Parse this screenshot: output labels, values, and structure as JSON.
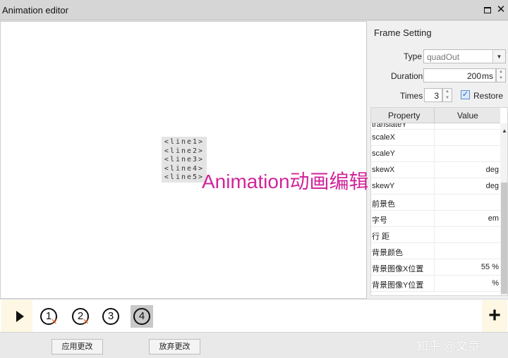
{
  "window": {
    "title": "Animation editor"
  },
  "canvas": {
    "lines": [
      "<line1>",
      "<line2>",
      "<line3>",
      "<line4>",
      "<line5>"
    ],
    "overlay_caption": "Animation动画编辑"
  },
  "frame_setting": {
    "title": "Frame Setting",
    "type_label": "Type",
    "type_value": "quadOut",
    "duration_label": "Duration",
    "duration_value": "200",
    "duration_unit": "ms",
    "times_label": "Times",
    "times_value": "3",
    "restore_label": "Restore",
    "restore_checked": true
  },
  "property_table": {
    "headers": [
      "Property",
      "Value"
    ],
    "partial_row": "translateY",
    "rows": [
      {
        "name": "scaleX",
        "value": ""
      },
      {
        "name": "scaleY",
        "value": ""
      },
      {
        "name": "skewX",
        "value": "deg"
      },
      {
        "name": "skewY",
        "value": "deg"
      },
      {
        "name": "前景色",
        "value": ""
      },
      {
        "name": "字号",
        "value": "em"
      },
      {
        "name": "行 距",
        "value": ""
      },
      {
        "name": "背景颜色",
        "value": ""
      },
      {
        "name": "背景图像X位置",
        "value": "55 %"
      },
      {
        "name": "背景图像Y位置",
        "value": "%"
      }
    ]
  },
  "timeline": {
    "frames": [
      {
        "label": "1",
        "has_x": true
      },
      {
        "label": "2",
        "has_x": true
      },
      {
        "label": "3",
        "has_x": false
      },
      {
        "label": "4",
        "has_x": false,
        "selected": true
      }
    ],
    "add_symbol": "+"
  },
  "footer": {
    "apply_label": "应用更改",
    "discard_label": "放弃更改",
    "watermark": "知乎 @文章"
  }
}
